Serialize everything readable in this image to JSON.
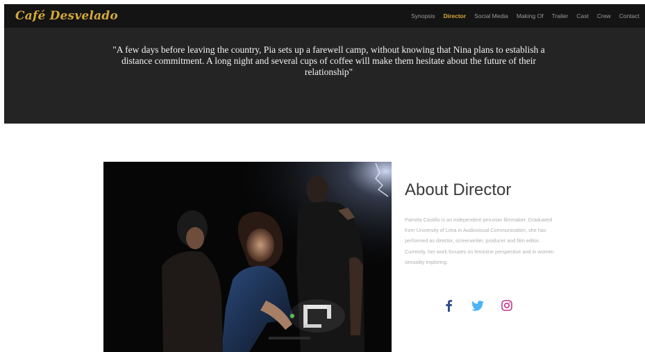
{
  "brand": {
    "name": "Café Desvelado",
    "color": "#d3a83a"
  },
  "nav": {
    "items": [
      {
        "label": "Synopsis",
        "active": false
      },
      {
        "label": "Director",
        "active": true
      },
      {
        "label": "Social Media",
        "active": false
      },
      {
        "label": "Making Of",
        "active": false
      },
      {
        "label": "Trailer",
        "active": false
      },
      {
        "label": "Cast",
        "active": false
      },
      {
        "label": "Crew",
        "active": false
      },
      {
        "label": "Contact",
        "active": false
      }
    ],
    "active_color": "#d8a936"
  },
  "hero": {
    "quote": "\"A few days before leaving the country, Pia sets up a farewell camp, without knowing that Nina plans to establish a distance commitment. A long night and several cups of coffee will make them hesitate about the future of their relationship\""
  },
  "about": {
    "title": "About Director",
    "text": "Pamela Castillo is an independent peruvian filmmaker. Graduated from University of Lima in Audiovisual Communication, she has performed as director, screenwriter, producer and film editor. Currently, her work focuses on feminine perspective and in women sexuality exploring.",
    "socials": [
      {
        "icon": "facebook-icon",
        "color": "#2f4f86"
      },
      {
        "icon": "twitter-icon",
        "color": "#4ab3f4"
      },
      {
        "icon": "instagram-icon",
        "color": "#c1358a"
      }
    ]
  }
}
